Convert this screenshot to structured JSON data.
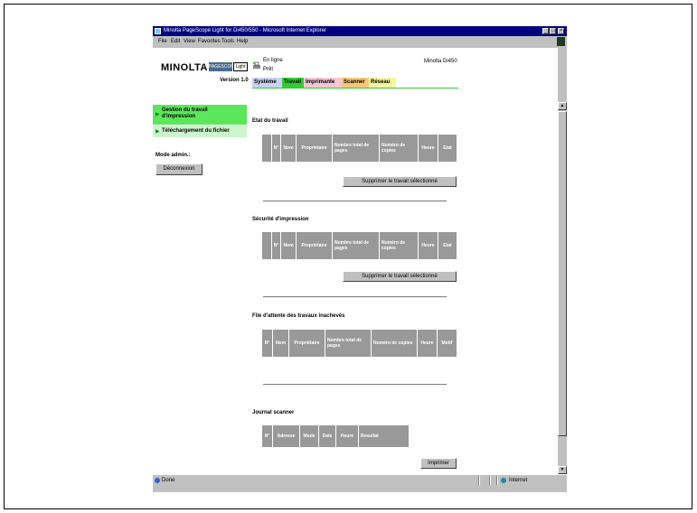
{
  "window": {
    "title": "Minolta PageScope Light for Di450/550 - Microsoft Internet Explorer"
  },
  "menu": [
    "File",
    "Edit",
    "View",
    "Favorites",
    "Tools",
    "Help"
  ],
  "header": {
    "logo": "MINOLTA",
    "logo_ps": "PAGESCOPE",
    "logo_light": "Light",
    "version": "Version 1.0",
    "status_line1": "En ligne",
    "status_line2": "Prêt",
    "model": "Minolta Di450",
    "tabs": [
      "Système",
      "Travail",
      "Imprimante",
      "Scanner",
      "Réseau"
    ]
  },
  "sidebar": {
    "item1": "Gestion du travail d'impression",
    "item2": "Téléchargement du fichier",
    "mode_label": "Mode admin.:",
    "logout": "Déconnexion"
  },
  "sections": {
    "etat": {
      "title": "Etat du travail",
      "columns": [
        "N°",
        "Nom",
        "Propriétaire",
        "Nombre total de pages",
        "Numéro de copies",
        "Heure",
        "Etat"
      ],
      "button": "Supprimer le travail sélectionné"
    },
    "securite": {
      "title": "Sécurité d'impression",
      "columns": [
        "N°",
        "Nom",
        "Propriétaire",
        "Nombre total de pages",
        "Numéro de copies",
        "Heure",
        "Etat"
      ],
      "button": "Supprimer le travail sélectionné"
    },
    "attente": {
      "title": "File d'attente des travaux inachevés",
      "columns": [
        "N°",
        "Nom",
        "Propriétaire",
        "Nombre total de pages",
        "Numéro de copies",
        "Heure",
        "Motif"
      ]
    },
    "journal": {
      "title": "Journal scanner",
      "columns": [
        "N°",
        "Adresse",
        "Mode",
        "Date",
        "Heure",
        "Resultat"
      ],
      "button": "Imprimer"
    }
  },
  "statusbar": {
    "left": "Done",
    "right": "Internet"
  },
  "colors": {
    "title_blue": "#000080",
    "tab_active": "#33cc33",
    "sidebar_active": "#5ce65c",
    "table_header": "#999999"
  }
}
